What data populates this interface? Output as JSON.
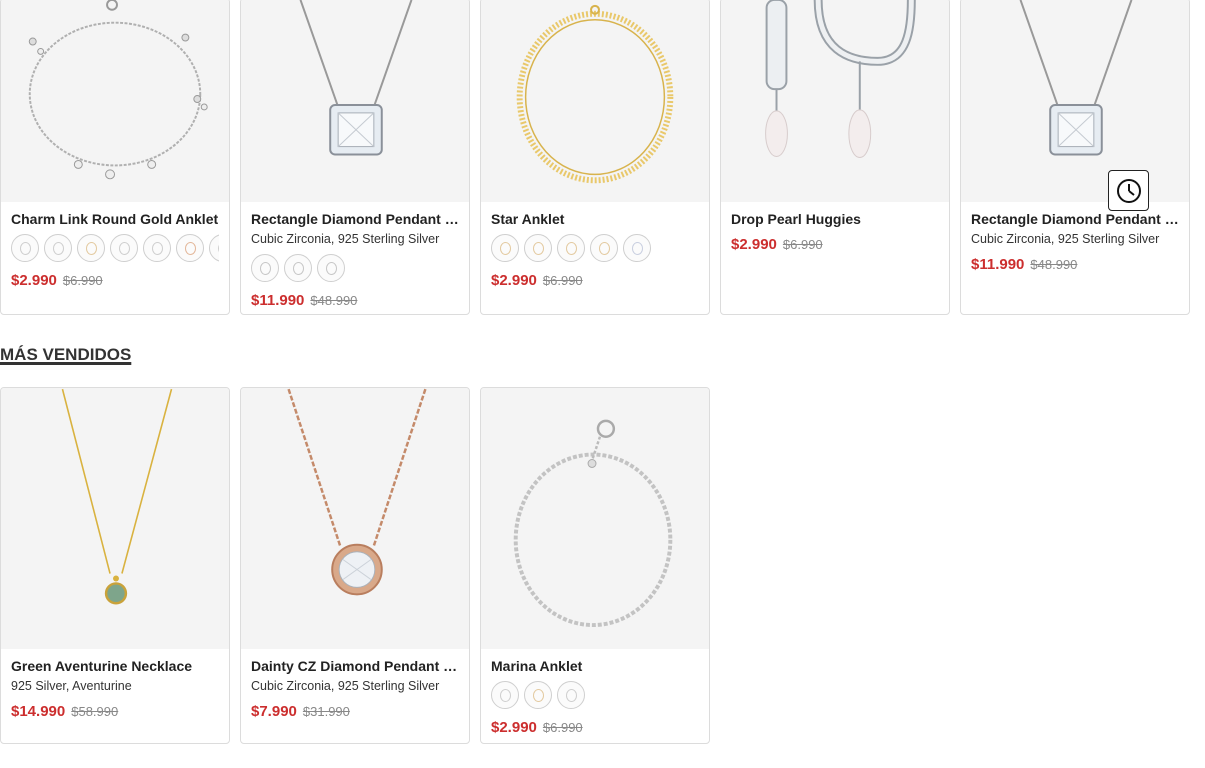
{
  "top_products": [
    {
      "name": "Charm Link Round Gold Anklet",
      "subtitle": "",
      "price": "$2.990",
      "old_price": "$6.990",
      "swatch_colors": [
        "#cfcfcf",
        "#cfcfcf",
        "#e3caa0",
        "#cfcfcf",
        "#cfcfcf",
        "#e3b79a",
        "#cfcfcf"
      ],
      "image_icon": "anklet-charm-image"
    },
    {
      "name": "Rectangle Diamond Pendant Ne...",
      "subtitle": "Cubic Zirconia, 925 Sterling Silver",
      "price": "$11.990",
      "old_price": "$48.990",
      "swatch_colors": [
        "#cfcfcf",
        "#cfcfcf",
        "#cfcfcf"
      ],
      "image_icon": "pendant-necklace-image"
    },
    {
      "name": "Star Anklet",
      "subtitle": "",
      "price": "$2.990",
      "old_price": "$6.990",
      "swatch_colors": [
        "#e3caa0",
        "#e3caa0",
        "#e3caa0",
        "#e3caa0",
        "#cfcfcf"
      ],
      "image_icon": "gold-anklet-image"
    },
    {
      "name": "Drop Pearl Huggies",
      "subtitle": "",
      "price": "$2.990",
      "old_price": "$6.990",
      "swatch_colors": [],
      "image_icon": "pearl-earrings-image"
    },
    {
      "name": "Rectangle Diamond Pendant Ne...",
      "subtitle": "Cubic Zirconia, 925 Sterling Silver",
      "price": "$11.990",
      "old_price": "$48.990",
      "swatch_colors": [],
      "image_icon": "pendant-necklace-image"
    }
  ],
  "section": {
    "title": "MÁS VENDIDOS"
  },
  "best_sellers": [
    {
      "name": "Green Aventurine Necklace",
      "subtitle": "925 Silver, Aventurine",
      "price": "$14.990",
      "old_price": "$58.990",
      "swatch_colors": [],
      "image_icon": "aventurine-necklace-image"
    },
    {
      "name": "Dainty CZ Diamond Pendant Ne...",
      "subtitle": "Cubic Zirconia, 925 Sterling Silver",
      "price": "$7.990",
      "old_price": "$31.990",
      "swatch_colors": [],
      "image_icon": "rose-gold-pendant-image"
    },
    {
      "name": "Marina Anklet",
      "subtitle": "",
      "price": "$2.990",
      "old_price": "$6.990",
      "swatch_colors": [
        "#cfcfcf",
        "#e3caa0",
        "#cfcfcf"
      ],
      "image_icon": "silver-anklet-image"
    }
  ],
  "history_button": {
    "icon": "clock-icon"
  }
}
